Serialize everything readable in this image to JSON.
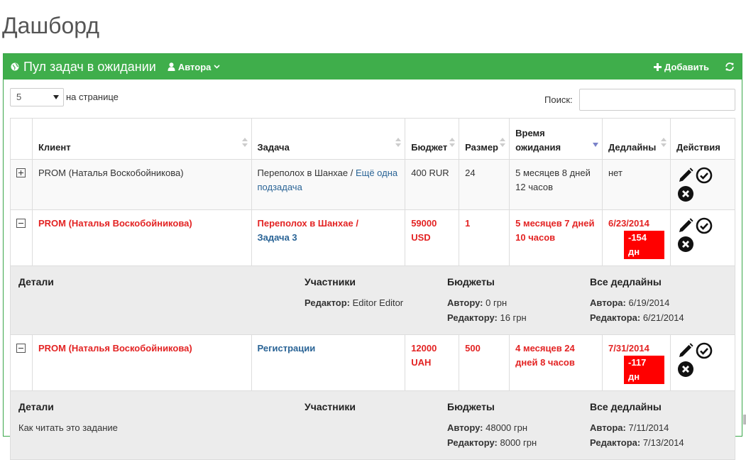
{
  "page": {
    "title": "Дашборд"
  },
  "panel": {
    "title": "Пул задач в ожидании",
    "user_filter": "Автора",
    "add_label": "Добавить",
    "accent": "#3fae4b"
  },
  "controls": {
    "page_length": "5",
    "page_length_label": "на странице",
    "search_label": "Поиск:",
    "search_value": ""
  },
  "table": {
    "headers": {
      "client": "Клиент",
      "task": "Задача",
      "budget": "Бюджет",
      "size": "Размер",
      "wait_line1": "Время",
      "wait_line2": "ожидания",
      "deadlines": "Дедлайны",
      "actions": "Действия"
    },
    "rows": [
      {
        "client": "PROM (Наталья Воскобойникова)",
        "task_prefix": "Переполох в Шанхае / ",
        "task_link": "Ещё одна подзадача",
        "budget": "400 RUR",
        "size": "24",
        "wait": "5 месяцев 8 дней 12 часов",
        "deadline": "нет"
      },
      {
        "client": "PROM (Наталья Воскобойникова)",
        "task_prefix": "Переполох в Шанхае /",
        "task_link": "Задача 3",
        "budget_line1": "59000",
        "budget_line2": "USD",
        "size": "1",
        "wait": "5 месяцев 7 дней 10 часов",
        "deadline": "6/23/2014",
        "overdue": "-154 дн",
        "details": {
          "h_details": "Детали",
          "h_participants": "Участники",
          "h_budgets": "Бюджеты",
          "h_deadlines": "Все дедлайны",
          "description": "",
          "editor_label": "Редактор:",
          "editor_value": "Editor Editor",
          "budget_author_label": "Автору:",
          "budget_author_value": "0 грн",
          "budget_editor_label": "Редактору:",
          "budget_editor_value": "16 грн",
          "deadline_author_label": "Автора:",
          "deadline_author_value": "6/19/2014",
          "deadline_editor_label": "Редактора:",
          "deadline_editor_value": "6/21/2014"
        }
      },
      {
        "client": "PROM (Наталья Воскобойникова)",
        "task_link": "Регистрации",
        "budget_line1": "12000",
        "budget_line2": "UAH",
        "size": "500",
        "wait": "4 месяцев 24 дней 8 часов",
        "deadline": "7/31/2014",
        "overdue": "-117 дн",
        "details": {
          "h_details": "Детали",
          "h_participants": "Участники",
          "h_budgets": "Бюджеты",
          "h_deadlines": "Все дедлайны",
          "description": "Как читать это задание",
          "budget_author_label": "Автору:",
          "budget_author_value": "48000 грн",
          "budget_editor_label": "Редактору:",
          "budget_editor_value": "8000 грн",
          "deadline_author_label": "Автора:",
          "deadline_author_value": "7/11/2014",
          "deadline_editor_label": "Редактора:",
          "deadline_editor_value": "7/13/2014"
        }
      }
    ]
  },
  "icons": {
    "globe": "globe-icon",
    "user": "user-icon",
    "plus": "plus-icon",
    "refresh": "refresh-icon",
    "edit": "pencil-icon",
    "approve": "check-circle-icon",
    "delete": "x-circle-icon"
  },
  "colors": {
    "overdue_badge": "#ff0000",
    "urgent_text": "#e32323",
    "link": "#2a6496"
  }
}
